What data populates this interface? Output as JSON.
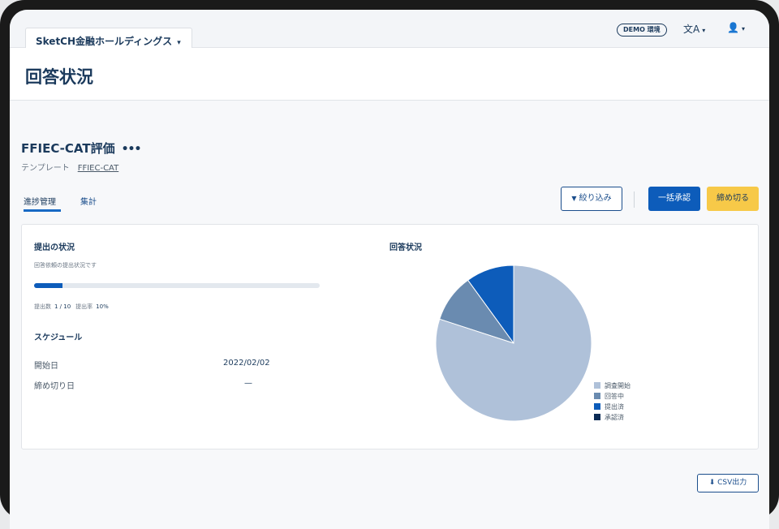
{
  "org": {
    "name": "SketCH金融ホールディングス",
    "caret": "▾"
  },
  "topbar": {
    "env_badge": "DEMO 環境",
    "lang_icon": "文A",
    "user_icon": "👤",
    "caret": "▾"
  },
  "page": {
    "title": "回答状況"
  },
  "project": {
    "title": "FFIEC-CAT評価",
    "more": "•••",
    "template_label": "テンプレート",
    "template_link": "FFIEC-CAT"
  },
  "tabs": [
    {
      "label": "進捗管理",
      "active": true
    },
    {
      "label": "集計",
      "active": false
    }
  ],
  "actions": {
    "filter_icon": "▼",
    "filter_label": "絞り込み",
    "approve_label": "一括承認",
    "close_label": "締め切る"
  },
  "submission": {
    "title": "提出の状況",
    "subtitle": "回答依頼の提出状況です",
    "progress": 0.1,
    "count_label": "提出数",
    "count_value": "1 / 10",
    "rate_label": "提出率",
    "rate_value": "10%"
  },
  "schedule": {
    "title": "スケジュール",
    "start_label": "開始日",
    "start_value": "2022/02/02",
    "deadline_label": "締め切り日",
    "deadline_value": "—"
  },
  "status_chart": {
    "title": "回答状況",
    "colors": {
      "investigating": "#afc1d9",
      "answering": "#6a8bb0",
      "submitted": "#0d5cba",
      "approved": "#0b2b55"
    }
  },
  "chart_data": {
    "type": "pie",
    "categories": [
      "調査開始",
      "回答中",
      "提出済",
      "承認済"
    ],
    "values": [
      8,
      1,
      1,
      0
    ]
  },
  "export": {
    "icon": "⬇",
    "label": "CSV出力"
  }
}
